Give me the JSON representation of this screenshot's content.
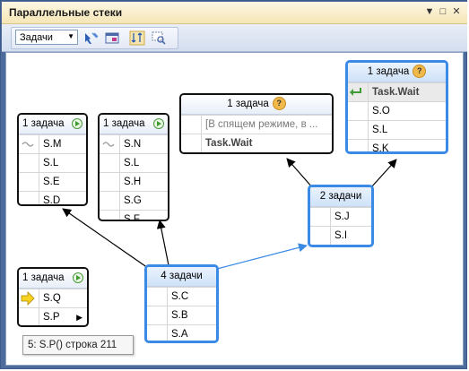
{
  "window": {
    "title": "Параллельные стеки",
    "controls": [
      "▼",
      "□",
      "✕"
    ]
  },
  "toolbar": {
    "view_select": "Задачи",
    "buttons": [
      "toggle-method-view-icon",
      "external-code-icon",
      "auto-scroll-icon",
      "zoom-icon"
    ]
  },
  "nodes": {
    "n1": {
      "header": "1 задача",
      "rows": [
        "S.M",
        "S.L",
        "S.E",
        "S.D"
      ]
    },
    "n2": {
      "header": "1 задача",
      "rows": [
        "S.N",
        "S.L",
        "S.H",
        "S.G",
        "S.F"
      ]
    },
    "n3": {
      "header": "1 задача",
      "rows": [
        "[В спящем режиме, в ...",
        "Task.Wait"
      ]
    },
    "n4": {
      "header": "1 задача",
      "rows": [
        "Task.Wait",
        "S.O",
        "S.L",
        "S.K"
      ]
    },
    "n5": {
      "header": "2 задачи",
      "rows": [
        "S.J",
        "S.I"
      ]
    },
    "n6": {
      "header": "1 задача",
      "rows": [
        "S.Q",
        "S.P"
      ]
    },
    "n7": {
      "header": "4 задачи",
      "rows": [
        "S.C",
        "S.B",
        "S.A"
      ]
    }
  },
  "tooltip": "5: S.P() строка 211",
  "colors": {
    "active_border": "#3b8ae6",
    "arrow_blue": "#3b8ae6",
    "arrow_black": "#000000"
  }
}
